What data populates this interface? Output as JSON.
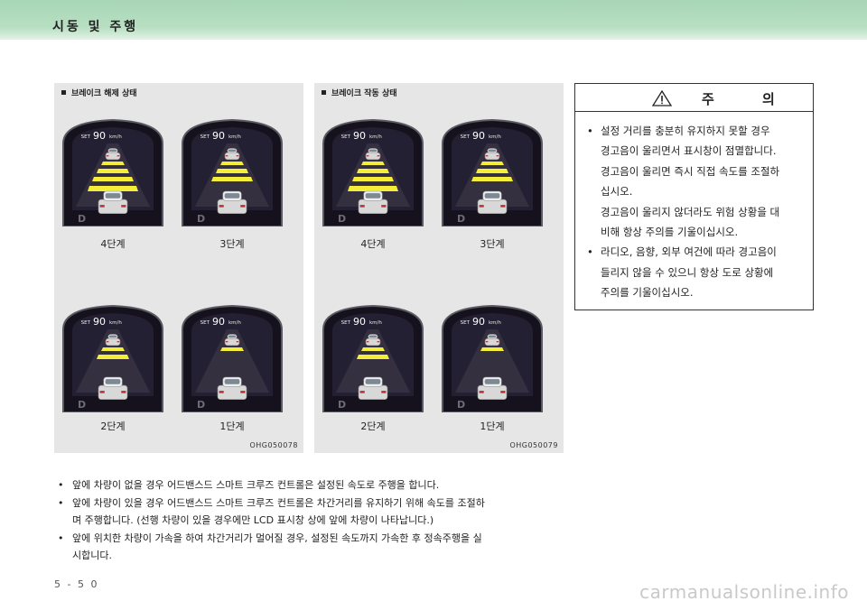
{
  "header": {
    "section_title": "시동 및 주행"
  },
  "panels": [
    {
      "heading": "브레이크 해제 상태",
      "image_code": "OHG050078",
      "gauges": [
        {
          "set_label": "SET",
          "speed": "90",
          "unit": "km/h",
          "stage_label": "4단계",
          "bars": 4
        },
        {
          "set_label": "SET",
          "speed": "90",
          "unit": "km/h",
          "stage_label": "3단계",
          "bars": 3
        },
        {
          "set_label": "SET",
          "speed": "90",
          "unit": "km/h",
          "stage_label": "2단계",
          "bars": 2
        },
        {
          "set_label": "SET",
          "speed": "90",
          "unit": "km/h",
          "stage_label": "1단계",
          "bars": 1
        }
      ]
    },
    {
      "heading": "브레이크 작동 상태",
      "image_code": "OHG050079",
      "gauges": [
        {
          "set_label": "SET",
          "speed": "90",
          "unit": "km/h",
          "stage_label": "4단계",
          "bars": 4
        },
        {
          "set_label": "SET",
          "speed": "90",
          "unit": "km/h",
          "stage_label": "3단계",
          "bars": 3
        },
        {
          "set_label": "SET",
          "speed": "90",
          "unit": "km/h",
          "stage_label": "2단계",
          "bars": 2
        },
        {
          "set_label": "SET",
          "speed": "90",
          "unit": "km/h",
          "stage_label": "1단계",
          "bars": 1
        }
      ]
    }
  ],
  "caution": {
    "title": "주 의",
    "items": [
      [
        "설정 거리를 충분히 유지하지 못할 경우",
        "경고음이 울리면서 표시창이 점멸합니다.",
        "경고음이 울리면 즉시 직접 속도를 조절하",
        "십시오.",
        "경고음이 울리지 않더라도 위험 상황을 대",
        "비해 항상 주의를 기울이십시오."
      ],
      [
        "라디오, 음향, 외부 여건에 따라 경고음이",
        "들리지 않을 수 있으니 항상 도로 상황에",
        "주의를 기울이십시오."
      ]
    ]
  },
  "notes": [
    [
      "앞에 차량이 없을 경우 어드밴스드 스마트 크루즈 컨트롤은 설정된 속도로 주행을 합니다."
    ],
    [
      "앞에 차량이 있을 경우 어드밴스드 스마트 크루즈 컨트롤은 차간거리를 유지하기 위해 속도를 조절하",
      "며 주행합니다. (선행 차량이 있을 경우에만 LCD 표시창 상에 앞에 차량이 나타납니다.)"
    ],
    [
      "앞에 위치한 차량이 가속을 하여 차간거리가 멀어질 경우, 설정된 속도까지 가속한 후 정속주행을 실",
      "시합니다."
    ]
  ],
  "page_number": "5 - 5 0",
  "watermark": "carmanualsonline.info",
  "colors": {
    "header_bar": "#a7d6b6",
    "panel_bg": "#e6e6e6",
    "bar_yellow": "#f4ee3a"
  }
}
